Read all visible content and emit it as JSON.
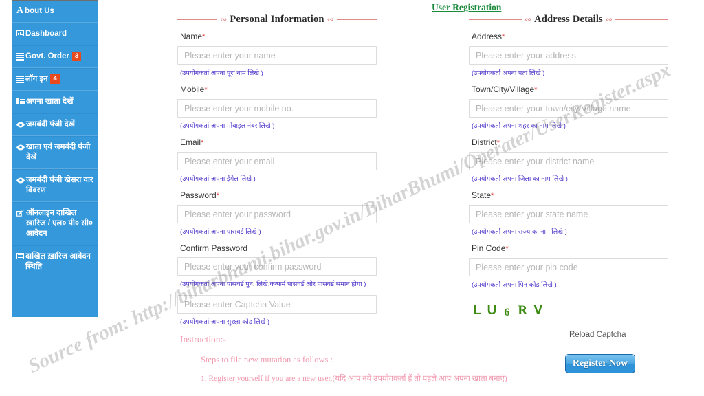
{
  "page": {
    "title": "User Registration",
    "watermark": "Source from: http://biharbhumi.bihar.gov.in/BiharBhumi/Operater/UserRegister.aspx",
    "accent_blue": "#3498db",
    "badge_red": "#e8491d",
    "title_green": "#1a8a3c",
    "hint_purple": "#4a33c9",
    "instruction_pink": "#f09ab0",
    "captcha_green": "#3f8c14"
  },
  "sidebar": {
    "items": [
      {
        "label": "bout Us",
        "prefix": "A",
        "icon": "letter-a-icon",
        "badge": ""
      },
      {
        "label": "Dashboard",
        "prefix": "",
        "icon": "dashboard-chart-icon",
        "badge": ""
      },
      {
        "label": "Govt. Order",
        "prefix": "",
        "icon": "bars-icon",
        "badge": "3"
      },
      {
        "label": "लॉग इन",
        "prefix": "",
        "icon": "bars-icon",
        "badge": "4"
      },
      {
        "label": "अपना खाता देखें",
        "prefix": "",
        "icon": "side-list-icon",
        "badge": ""
      },
      {
        "label": "जमबंदी पंजी देखें",
        "prefix": "",
        "icon": "eye-icon",
        "badge": ""
      },
      {
        "label": "खाता एवं जमबंदी पंजी देखें",
        "prefix": "",
        "icon": "eye-icon",
        "badge": ""
      },
      {
        "label": "जमबंदी पंजी खेसरा वार विवरण",
        "prefix": "",
        "icon": "eye-icon",
        "badge": ""
      },
      {
        "label": "ऑनलाइन दाखिल ख़ारिज / एल० पी० सी० आवेदन",
        "prefix": "",
        "icon": "pencil-icon",
        "badge": ""
      },
      {
        "label": "दाखिल ख़ारिज आवेदन स्थिति",
        "prefix": "",
        "icon": "list-icon",
        "badge": ""
      }
    ]
  },
  "personal": {
    "heading": "Personal Information",
    "fields": [
      {
        "label": "Name",
        "required": "*",
        "placeholder": "Please enter your name",
        "hint": "(उपयोगकर्ता अपना पूरा नाम लिखे )"
      },
      {
        "label": "Mobile",
        "required": "*",
        "placeholder": "Please enter your mobile no.",
        "hint": "(उपयोगकर्ता अपना मोबाइल नंबर लिखे )"
      },
      {
        "label": "Email",
        "required": "*",
        "placeholder": "Please enter your email",
        "hint": "(उपयोगकर्ता अपना ईमेल लिखे )"
      },
      {
        "label": "Password",
        "required": "*",
        "placeholder": "Please enter your password",
        "hint": "(उपयोगकर्ता अपना पासवर्ड लिखे )"
      },
      {
        "label": "Confirm Password",
        "required": "",
        "placeholder": "Please enter your confirm password",
        "hint": "(उपयोगकर्ता अपना पासवर्ड पुन: लिखे,कन्फर्म पासवर्ड ओर पासवर्ड समान होगा )"
      }
    ],
    "captcha_input_placeholder": "Please enter Captcha Value",
    "captcha_input_hint": "(उपयोगकर्ता अपना सुरक्षा कोड लिखे )"
  },
  "address": {
    "heading": "Address Details",
    "fields": [
      {
        "label": "Address",
        "required": "*",
        "placeholder": "Please enter your address",
        "hint": "(उपयोगकर्ता अपना पता लिखे )"
      },
      {
        "label": "Town/City/Village",
        "required": "*",
        "placeholder": "Please enter your town/city/Village name",
        "hint": "(उपयोगकर्ता अपना शहर का नाम लिखे )"
      },
      {
        "label": "District",
        "required": "*",
        "placeholder": "Please enter your district name",
        "hint": "(उपयोगकर्ता अपना जिला का नाम लिखे )"
      },
      {
        "label": "State",
        "required": "*",
        "placeholder": "Please enter your state name",
        "hint": "(उपयोगकर्ता अपना राज्य का नाम लिखे )"
      },
      {
        "label": "Pin Code",
        "required": "*",
        "placeholder": "Please enter your pin code",
        "hint": "(उपयोगकर्ता अपना पिन कोड लिखे )"
      }
    ]
  },
  "captcha": {
    "chars": [
      "L",
      "U",
      "6",
      "R",
      "V"
    ],
    "text": "LU6RV",
    "reload_label": "Reload Captcha"
  },
  "actions": {
    "register_label": "Register Now"
  },
  "instructions": {
    "title": "Instruction:-",
    "subtitle": "Steps to file new mutation as follows :",
    "step1": "1. Register yourself if you are a new user.(यदि आप नये उपयोगकर्ता हैं तो पहले आप अपना खाता बनाएं)"
  }
}
